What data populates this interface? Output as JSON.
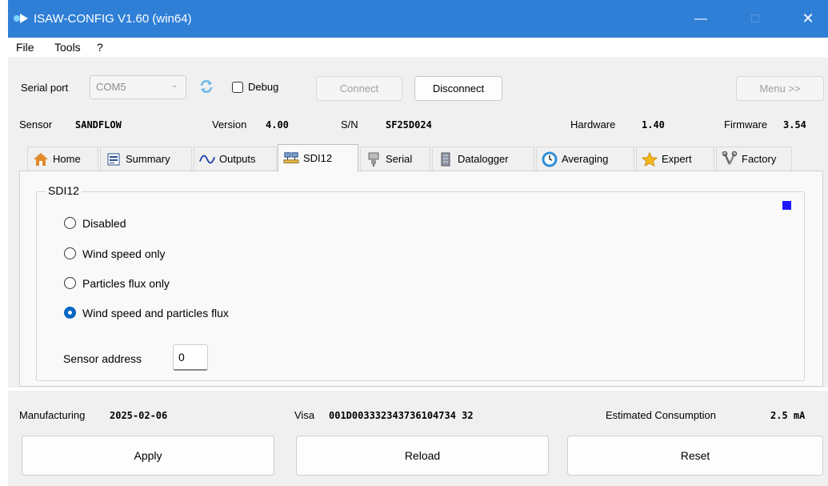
{
  "window": {
    "title": "ISAW-CONFIG V1.60 (win64)",
    "minimize": "—",
    "maximize": "□",
    "close": "✕"
  },
  "menu": [
    "File",
    "Tools",
    "?"
  ],
  "toolbar": {
    "serial_port_label": "Serial port",
    "serial_port_value": "COM5",
    "debug_label": "Debug",
    "connect_label": "Connect",
    "disconnect_label": "Disconnect",
    "menu_label": "Menu >>"
  },
  "sensor_info": {
    "sensor_label": "Sensor",
    "sensor_value": "SANDFLOW",
    "version_label": "Version",
    "version_value": "4.00",
    "sn_label": "S/N",
    "sn_value": "SF25D024",
    "hardware_label": "Hardware",
    "hardware_value": "1.40",
    "firmware_label": "Firmware",
    "firmware_value": "3.54"
  },
  "tabs": [
    {
      "label": "Home",
      "icon": "home-icon"
    },
    {
      "label": "Summary",
      "icon": "summary-icon"
    },
    {
      "label": "Outputs",
      "icon": "wave-icon"
    },
    {
      "label": "SDI12",
      "icon": "network-icon",
      "active": true
    },
    {
      "label": "Serial",
      "icon": "connector-icon"
    },
    {
      "label": "Datalogger",
      "icon": "memory-icon"
    },
    {
      "label": "Averaging",
      "icon": "clock-icon"
    },
    {
      "label": "Expert",
      "icon": "star-icon"
    },
    {
      "label": "Factory",
      "icon": "tools-icon"
    }
  ],
  "sdi12": {
    "group_title": "SDI12",
    "options": [
      {
        "label": "Disabled",
        "selected": false
      },
      {
        "label": "Wind speed only",
        "selected": false
      },
      {
        "label": "Particles flux only",
        "selected": false
      },
      {
        "label": "Wind speed and particles flux",
        "selected": true
      }
    ],
    "address_label": "Sensor address",
    "address_value": "0",
    "indicator_color": "#1a1aff"
  },
  "footer": {
    "manufacturing_label": "Manufacturing",
    "manufacturing_value": "2025-02-06",
    "visa_label": "Visa",
    "visa_value": "001D003332343736104734 32",
    "consumption_label": "Estimated Consumption",
    "consumption_value": "2.5 mA"
  },
  "actions": {
    "apply": "Apply",
    "reload": "Reload",
    "reset": "Reset"
  },
  "colors": {
    "titlebar": "#2f7fd7",
    "accent": "#0067c0"
  }
}
